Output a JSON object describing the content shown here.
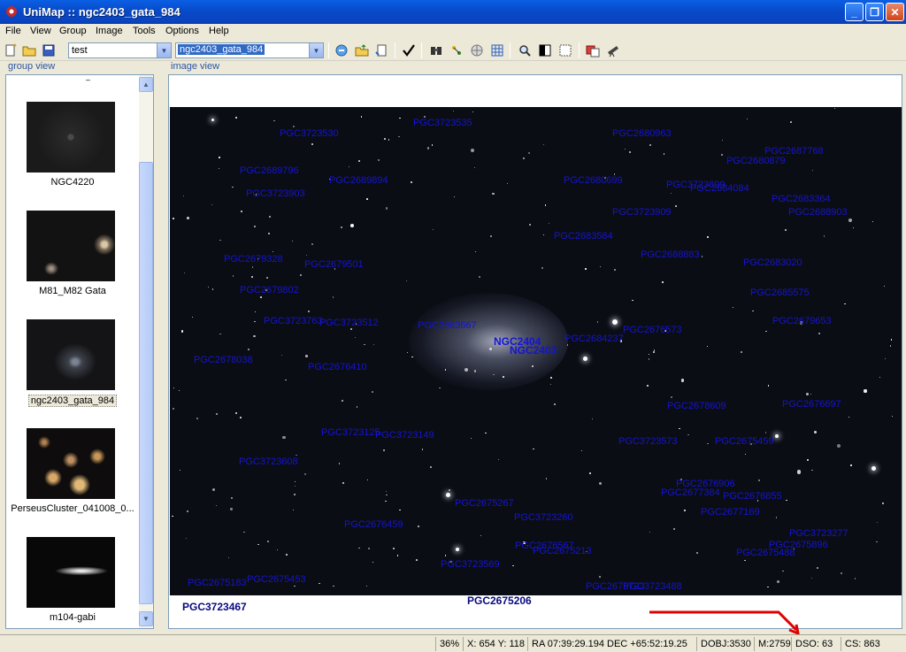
{
  "window": {
    "title": "UniMap :: ngc2403_gata_984",
    "minimize": "_",
    "maximize": "❐",
    "close": "✕"
  },
  "menu": [
    "File",
    "View",
    "Group",
    "Image",
    "Tools",
    "Options",
    "Help"
  ],
  "toolbar": {
    "group_select": "test",
    "image_select": "ngc2403_gata_984"
  },
  "panels": {
    "group_view_label": "group view",
    "image_view_label": "image view"
  },
  "thumbnails": [
    {
      "label": "NGC4220",
      "selected": false
    },
    {
      "label": "M81_M82 Gata",
      "selected": false
    },
    {
      "label": "ngc2403_gata_984",
      "selected": true
    },
    {
      "label": "PerseusCluster_041008_0...",
      "selected": false
    },
    {
      "label": "m104-gabi",
      "selected": false
    }
  ],
  "catalog_labels": {
    "main": [
      "NGC2404",
      "NGC2403"
    ],
    "pgc": [
      "PGC3723530",
      "PGC3723535",
      "PGC2680963",
      "PGC2687768",
      "PGC2680879",
      "PGC2689796",
      "PGC2689894",
      "PGC2680699",
      "PGC3723899",
      "PGC2684084",
      "PGC3723903",
      "PGC2683364",
      "PGC3723909",
      "PGC2688903",
      "PGC2683584",
      "PGC2688883",
      "PGC2679328",
      "PGC2679501",
      "PGC2683020",
      "PGC2679802",
      "PGC2685575",
      "PGC2663667",
      "PGC2679653",
      "PGC2684237",
      "PGC3723763",
      "PGC2676573",
      "PGC2678038",
      "PGC2676410",
      "PGC3723512",
      "PGC2678609",
      "PGC2676697",
      "PGC3723125",
      "PGC3723149",
      "PGC3723573",
      "PGC2675459",
      "PGC3723608",
      "PGC2676906",
      "PGC2677384",
      "PGC2675267",
      "PGC2676855",
      "PGC2676459",
      "PGC3723260",
      "PGC2677169",
      "PGC3723277",
      "PGC2675896",
      "PGC2675488",
      "PGC2675213",
      "PGC2676567",
      "PGC3723569",
      "PGC2675183",
      "PGC2675723",
      "PGC3723488",
      "PGC2675453"
    ],
    "bottom_left": "PGC3723467",
    "bottom_center": "PGC2675206"
  },
  "status": {
    "zoom": "36%",
    "xy": "X: 654 Y: 118",
    "radec": "RA  07:39:29.194 DEC +65:52:19.25",
    "dobj": "DOBJ:3530",
    "m": "M:2759",
    "dso": "DSO:  63",
    "cs": "CS: 863"
  },
  "colors": {
    "titlebar": "#0a5fe4",
    "label_blue": "#1414d2",
    "annotation_red": "#e00000"
  }
}
